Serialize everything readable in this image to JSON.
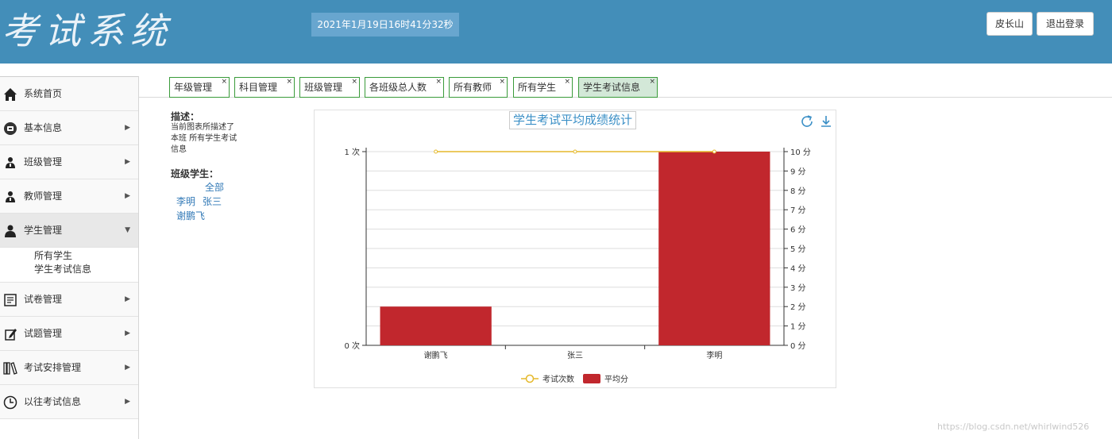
{
  "header": {
    "logo": "考试系统",
    "clock": "2021年1月19日16时41分32秒",
    "user_btn": "皮长山",
    "logout_btn": "退出登录"
  },
  "sidebar": {
    "items": [
      {
        "label": "系统首页",
        "icon": "home-icon",
        "arrow": ""
      },
      {
        "label": "基本信息",
        "icon": "info-icon",
        "arrow": "▶"
      },
      {
        "label": "班级管理",
        "icon": "users-icon",
        "arrow": "▶"
      },
      {
        "label": "教师管理",
        "icon": "users-icon",
        "arrow": "▶"
      },
      {
        "label": "学生管理",
        "icon": "user-icon",
        "arrow": "▼"
      },
      {
        "label": "试卷管理",
        "icon": "document-icon",
        "arrow": "▶"
      },
      {
        "label": "试题管理",
        "icon": "edit-icon",
        "arrow": "▶"
      },
      {
        "label": "考试安排管理",
        "icon": "books-icon",
        "arrow": "▶"
      },
      {
        "label": "以往考试信息",
        "icon": "clock-icon",
        "arrow": "▶"
      }
    ],
    "submenu": [
      "所有学生",
      "学生考试信息"
    ]
  },
  "tabs": [
    {
      "label": "年级管理",
      "close": "×"
    },
    {
      "label": "科目管理",
      "close": "×"
    },
    {
      "label": "班级管理",
      "close": "×"
    },
    {
      "label": "各班级总人数",
      "close": "×"
    },
    {
      "label": "所有教师",
      "close": "×"
    },
    {
      "label": "所有学生",
      "close": "×"
    },
    {
      "label": "学生考试信息",
      "close": "×"
    }
  ],
  "info": {
    "desc_title": "描述：",
    "desc_line1": "当前图表所描述了",
    "desc_line2": "本班 所有学生考试",
    "desc_line3": "信息",
    "students_title": "班级学生：",
    "students": {
      "all": "全部",
      "s1": "李明",
      "s2": "张三",
      "s3": "谢鹏飞"
    }
  },
  "chart_data": {
    "type": "bar",
    "title": "学生考试平均成绩统计",
    "categories": [
      "谢鹏飞",
      "张三",
      "李明"
    ],
    "series": [
      {
        "name": "考试次数",
        "type": "line",
        "axis": "left",
        "values": [
          1,
          1,
          1
        ],
        "color": "#e5b92b"
      },
      {
        "name": "平均分",
        "type": "bar",
        "axis": "right",
        "values": [
          2,
          0,
          10
        ],
        "color": "#c1272d"
      }
    ],
    "y_left": {
      "min": 0,
      "max": 1,
      "ticks": [
        "0 次",
        "1 次"
      ]
    },
    "y_right": {
      "min": 0,
      "max": 10,
      "ticks": [
        "0 分",
        "1 分",
        "2 分",
        "3 分",
        "4 分",
        "5 分",
        "6 分",
        "7 分",
        "8 分",
        "9 分",
        "10 分"
      ]
    },
    "grid": true,
    "legend": "bottom-center"
  },
  "watermark": "https://blog.csdn.net/whirlwind526",
  "colors": {
    "header": "#438eb9",
    "tab_border": "#3a9b3a",
    "bar": "#c1272d",
    "line": "#e5b92b",
    "link": "#337ab7"
  }
}
